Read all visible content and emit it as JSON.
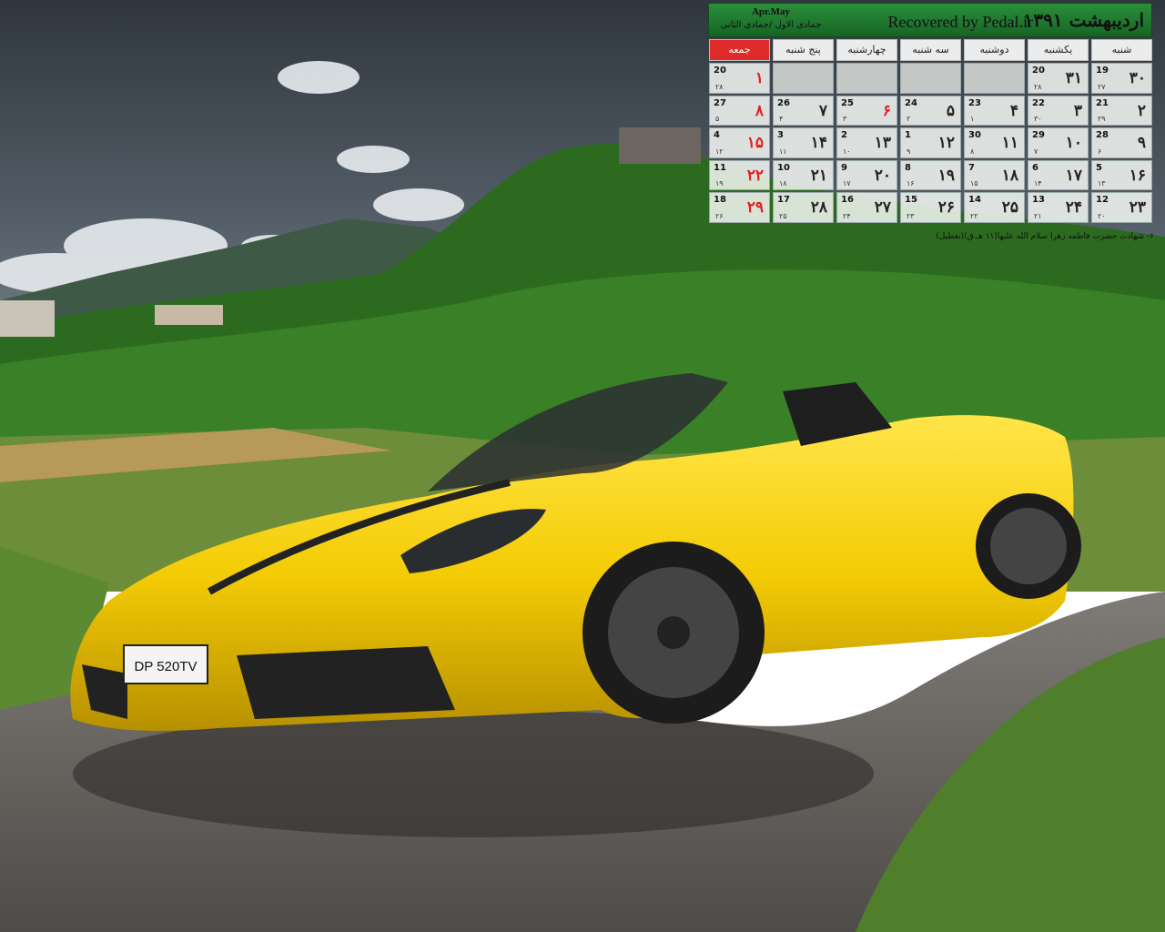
{
  "calendar": {
    "month_title": "اردیبهشت ۱۳۹۱",
    "brand": "Recovered by Pedal.ir",
    "gregorian_months": "Apr.May",
    "hijri_months": "جمادی الاول /جمادی الثانی",
    "weekdays": [
      "شنبه",
      "یکشنبه",
      "دوشنبه",
      "سه شنبه",
      "چهارشنبه",
      "پنج شنبه",
      "جمعه"
    ],
    "weeks": [
      [
        {
          "p": "۳۰",
          "g": "19",
          "h": "۲۷"
        },
        {
          "p": "۳۱",
          "g": "20",
          "h": "۲۸"
        },
        null,
        null,
        null,
        null,
        {
          "p": "۱",
          "g": "20",
          "h": "۲۸",
          "red": true
        }
      ],
      [
        {
          "p": "۲",
          "g": "21",
          "h": "۲۹"
        },
        {
          "p": "۳",
          "g": "22",
          "h": "۳۰"
        },
        {
          "p": "۴",
          "g": "23",
          "h": "۱"
        },
        {
          "p": "۵",
          "g": "24",
          "h": "۲"
        },
        {
          "p": "۶",
          "g": "25",
          "h": "۳",
          "red": true
        },
        {
          "p": "۷",
          "g": "26",
          "h": "۴"
        },
        {
          "p": "۸",
          "g": "27",
          "h": "۵",
          "red": true
        }
      ],
      [
        {
          "p": "۹",
          "g": "28",
          "h": "۶"
        },
        {
          "p": "۱۰",
          "g": "29",
          "h": "۷"
        },
        {
          "p": "۱۱",
          "g": "30",
          "h": "۸"
        },
        {
          "p": "۱۲",
          "g": "1",
          "h": "۹"
        },
        {
          "p": "۱۳",
          "g": "2",
          "h": "۱۰"
        },
        {
          "p": "۱۴",
          "g": "3",
          "h": "۱۱"
        },
        {
          "p": "۱۵",
          "g": "4",
          "h": "۱۲",
          "red": true
        }
      ],
      [
        {
          "p": "۱۶",
          "g": "5",
          "h": "۱۳"
        },
        {
          "p": "۱۷",
          "g": "6",
          "h": "۱۴"
        },
        {
          "p": "۱۸",
          "g": "7",
          "h": "۱۵"
        },
        {
          "p": "۱۹",
          "g": "8",
          "h": "۱۶"
        },
        {
          "p": "۲۰",
          "g": "9",
          "h": "۱۷"
        },
        {
          "p": "۲۱",
          "g": "10",
          "h": "۱۸"
        },
        {
          "p": "۲۲",
          "g": "11",
          "h": "۱۹",
          "red": true
        }
      ],
      [
        {
          "p": "۲۳",
          "g": "12",
          "h": "۲۰"
        },
        {
          "p": "۲۴",
          "g": "13",
          "h": "۲۱"
        },
        {
          "p": "۲۵",
          "g": "14",
          "h": "۲۲"
        },
        {
          "p": "۲۶",
          "g": "15",
          "h": "۲۳"
        },
        {
          "p": "۲۷",
          "g": "16",
          "h": "۲۴"
        },
        {
          "p": "۲۸",
          "g": "17",
          "h": "۲۵"
        },
        {
          "p": "۲۹",
          "g": "18",
          "h": "۲۶",
          "red": true
        }
      ]
    ],
    "note": "۶- شهادت حضرت فاطمه زهرا سلام الله علیها(۱۱ هـ.ق)(تعطیل)"
  },
  "car": {
    "plate": "DP 520TV"
  },
  "colors": {
    "sky": "#4a5560",
    "hills": "#2f6a1e",
    "car_yellow": "#f5d10a",
    "road": "#6d6a66",
    "calendar_green": "#1f7a2e",
    "friday_red": "#e02b2b"
  }
}
